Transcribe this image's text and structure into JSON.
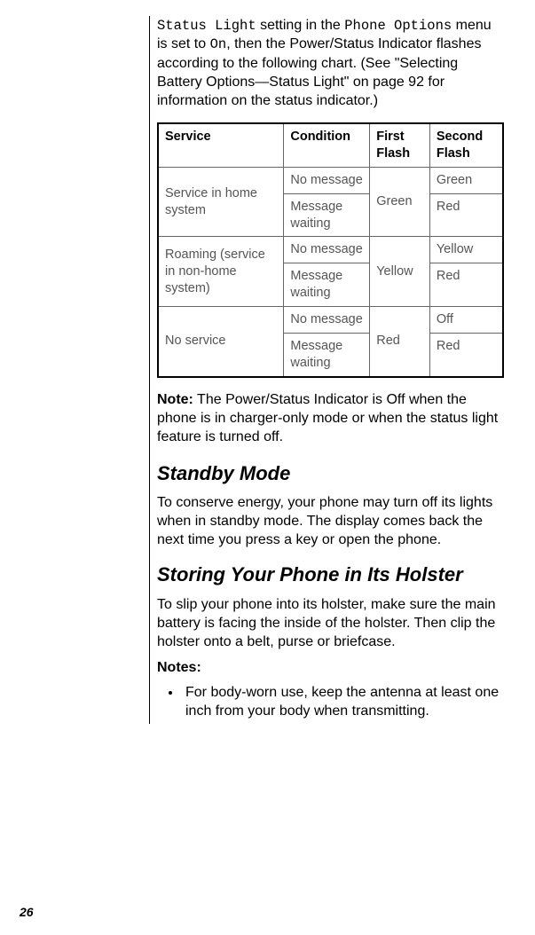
{
  "intro": {
    "mono1": "Status Light",
    "text1": " setting in the ",
    "mono2": "Phone Options",
    "text2": " menu is set to ",
    "mono3": "On",
    "text3": ", then the Power/Status Indicator flashes according to the following chart. (See \"Selecting Battery Options—Status Light\" on page 92 for information on the status indicator.)"
  },
  "table": {
    "headers": {
      "service": "Service",
      "condition": "Condition",
      "first": "First Flash",
      "second": "Second Flash"
    },
    "rows": {
      "r1": {
        "service": "Service in home system",
        "condition": "No message",
        "first": "Green",
        "second": "Green"
      },
      "r2": {
        "condition": "Message waiting",
        "second": "Red"
      },
      "r3": {
        "service": "Roaming (service in non-home system)",
        "condition": "No message",
        "first": "Yellow",
        "second": "Yellow"
      },
      "r4": {
        "condition": "Message waiting",
        "second": "Red"
      },
      "r5": {
        "service": "No service",
        "condition": "No message",
        "first": "Red",
        "second": "Off"
      },
      "r6": {
        "condition": "Message waiting",
        "second": "Red"
      }
    }
  },
  "note": {
    "label": "Note:",
    "text": " The Power/Status Indicator is Off when the phone is in charger-only mode or when the status light feature is turned off."
  },
  "standby": {
    "heading": "Standby Mode",
    "body": "To conserve energy, your phone may turn off its lights when in standby mode. The display comes back the next time you press a key or open the phone."
  },
  "holster": {
    "heading": "Storing Your Phone in Its Holster",
    "body": "To slip your phone into its holster, make sure the main battery is facing the inside of the holster. Then clip the holster onto a belt, purse or briefcase.",
    "notes_label": "Notes:",
    "note1": "For body-worn use, keep the antenna at least one inch from your body when transmitting."
  },
  "page_number": "26"
}
